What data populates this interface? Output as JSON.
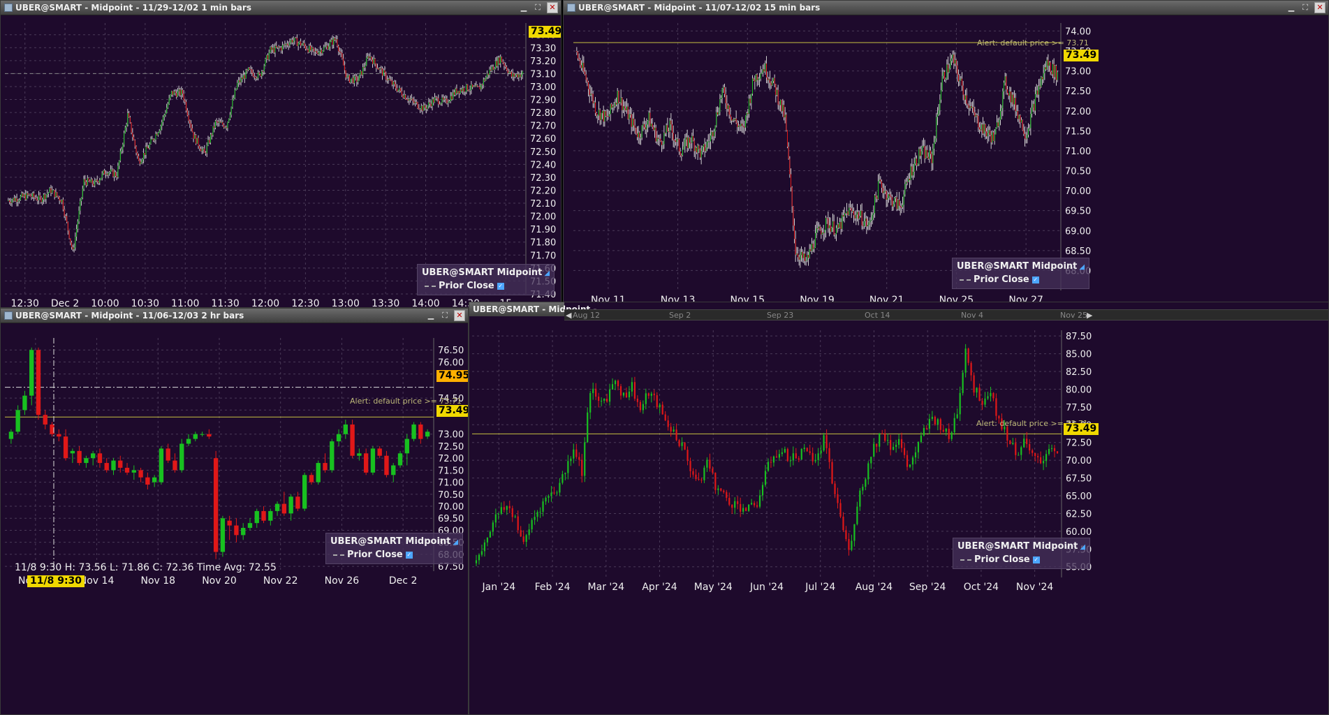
{
  "colors": {
    "bg": "#1e0a2c",
    "grid": "#4a3a58",
    "up": "#18c020",
    "down": "#e01818",
    "alert": "#c8c040",
    "tag": "#f0d800"
  },
  "panel_a": {
    "title": "UBER@SMART - Midpoint - 11/29-12/02 1 min bars",
    "price_tag": "73.49",
    "legend": {
      "series": "UBER@SMART Midpoint",
      "prior": "Prior Close"
    }
  },
  "panel_b": {
    "title": "UBER@SMART - Midpoint - 11/07-12/02 15 min bars",
    "price_tag": "73.49",
    "alert": "Alert: default price >= 73.71",
    "legend": {
      "series": "UBER@SMART Midpoint",
      "prior": "Prior Close"
    }
  },
  "panel_c": {
    "title": "UBER@SMART - Midpoint - 11/06-12/03 2 hr bars",
    "price_tag": "73.49",
    "cursor_tag": "74.95",
    "alert": "Alert: default price >= 73.71",
    "info": "11/8 9:30   H: 73.56   L: 71.86   C: 72.36   Time Avg: 72.55",
    "date_tag": "11/8 9:30",
    "legend": {
      "series": "UBER@SMART Midpoint",
      "prior": "Prior Close"
    }
  },
  "panel_d": {
    "title": "UBER@SMART - Midpoint -",
    "price_tag": "73.49",
    "alert": "Alert: default price >= 73.71",
    "scroll_labels": [
      "Aug 12",
      "Sep 2",
      "Sep 23",
      "Oct 14",
      "Nov 4",
      "Nov 25"
    ],
    "legend": {
      "series": "UBER@SMART Midpoint",
      "prior": "Prior Close"
    }
  },
  "chart_data": [
    {
      "id": "A",
      "type": "candlestick",
      "title": "UBER@SMART - Midpoint - 11/29-12/02 1 min bars",
      "ylim": [
        71.4,
        73.49
      ],
      "yticks": [
        73.4,
        73.3,
        73.2,
        73.1,
        73.0,
        72.9,
        72.8,
        72.7,
        72.6,
        72.5,
        72.4,
        72.3,
        72.2,
        72.1,
        72.0,
        71.9,
        71.8,
        71.7,
        71.6,
        71.5,
        71.4
      ],
      "xticks": [
        "12:30",
        "Dec 2",
        "10:00",
        "10:30",
        "11:00",
        "11:30",
        "12:00",
        "12:30",
        "13:00",
        "13:30",
        "14:00",
        "14:30",
        "15"
      ],
      "anchors": [
        72.12,
        72.14,
        72.16,
        72.13,
        72.2,
        72.12,
        71.72,
        72.27,
        72.25,
        72.35,
        72.32,
        72.78,
        72.42,
        72.55,
        72.7,
        72.95,
        72.95,
        72.62,
        72.48,
        72.72,
        72.7,
        73.02,
        73.12,
        73.08,
        73.28,
        73.3,
        73.36,
        73.32,
        73.26,
        73.3,
        73.37,
        73.06,
        73.05,
        73.24,
        73.13,
        73.03,
        72.95,
        72.88,
        72.83,
        72.9,
        72.88,
        72.97,
        72.99,
        72.98,
        73.12,
        73.22,
        73.08,
        73.1
      ],
      "prior_close": 73.1,
      "last": 73.49
    },
    {
      "id": "B",
      "type": "candlestick",
      "title": "UBER@SMART - Midpoint - 11/07-12/02 15 min bars",
      "ylim": [
        67.5,
        74.2
      ],
      "yticks": [
        74.0,
        73.5,
        73.0,
        72.5,
        72.0,
        71.5,
        71.0,
        70.5,
        70.0,
        69.5,
        69.0,
        68.5,
        68.0
      ],
      "xticks": [
        "Nov 11",
        "Nov 13",
        "Nov 15",
        "Nov 19",
        "Nov 21",
        "Nov 25",
        "Nov 27"
      ],
      "anchors": [
        73.5,
        72.8,
        72.0,
        71.8,
        72.4,
        71.9,
        71.4,
        71.8,
        71.2,
        71.6,
        71.0,
        71.3,
        70.9,
        71.4,
        72.5,
        71.8,
        71.5,
        72.8,
        73.1,
        72.6,
        71.8,
        68.5,
        68.2,
        68.9,
        69.2,
        69.0,
        69.5,
        69.4,
        69.1,
        70.2,
        69.8,
        69.6,
        70.5,
        71.0,
        70.8,
        72.8,
        73.3,
        72.5,
        71.9,
        71.5,
        71.3,
        72.7,
        72.1,
        71.4,
        72.4,
        73.2,
        72.9
      ],
      "alert": 73.71,
      "last": 73.49
    },
    {
      "id": "C",
      "type": "candlestick",
      "title": "UBER@SMART - Midpoint - 11/06-12/03 2 hr bars",
      "ylim": [
        67.3,
        77.0
      ],
      "yticks": [
        76.5,
        76.0,
        75.5,
        74.5,
        74.0,
        73.0,
        72.5,
        72.0,
        71.5,
        71.0,
        70.5,
        70.0,
        69.5,
        69.0,
        68.5,
        68.0,
        67.5
      ],
      "xticks": [
        "Nov 12",
        "Nov 14",
        "Nov 18",
        "Nov 20",
        "Nov 22",
        "Nov 26",
        "Dec 2"
      ],
      "ohlc": [
        [
          72.8,
          73.2,
          72.6,
          73.1
        ],
        [
          73.1,
          74.2,
          73.0,
          74.0
        ],
        [
          74.0,
          74.8,
          73.8,
          74.6
        ],
        [
          74.6,
          76.6,
          74.2,
          76.5
        ],
        [
          76.5,
          76.6,
          73.6,
          73.8
        ],
        [
          73.8,
          74.0,
          73.2,
          73.4
        ],
        [
          73.4,
          73.5,
          72.9,
          73.0
        ],
        [
          73.0,
          73.2,
          72.7,
          72.9
        ],
        [
          72.9,
          73.2,
          71.9,
          72.0
        ],
        [
          72.2,
          72.4,
          71.8,
          72.3
        ],
        [
          72.3,
          72.5,
          71.7,
          71.8
        ],
        [
          71.8,
          72.1,
          71.6,
          72.0
        ],
        [
          72.0,
          72.3,
          71.7,
          72.2
        ],
        [
          72.2,
          72.4,
          71.6,
          71.8
        ],
        [
          71.8,
          72.0,
          71.4,
          71.5
        ],
        [
          71.5,
          72.0,
          71.3,
          71.9
        ],
        [
          71.9,
          72.1,
          71.4,
          71.6
        ],
        [
          71.6,
          71.8,
          71.3,
          71.4
        ],
        [
          71.4,
          71.7,
          71.1,
          71.5
        ],
        [
          71.5,
          71.6,
          71.0,
          71.2
        ],
        [
          71.2,
          71.4,
          70.7,
          70.9
        ],
        [
          71.0,
          71.3,
          70.8,
          71.2
        ],
        [
          71.0,
          72.5,
          70.9,
          72.4
        ],
        [
          72.4,
          72.6,
          71.8,
          71.9
        ],
        [
          71.9,
          72.2,
          71.4,
          71.5
        ],
        [
          71.5,
          72.8,
          71.4,
          72.6
        ],
        [
          72.6,
          73.0,
          72.5,
          72.8
        ],
        [
          72.8,
          73.1,
          72.7,
          73.0
        ],
        [
          73.0,
          73.1,
          72.9,
          73.0
        ],
        [
          73.0,
          73.2,
          72.8,
          72.9
        ],
        [
          72.0,
          72.3,
          67.8,
          68.1
        ],
        [
          68.1,
          69.6,
          67.9,
          69.5
        ],
        [
          69.4,
          69.6,
          68.6,
          69.2
        ],
        [
          69.2,
          69.5,
          68.5,
          68.8
        ],
        [
          68.8,
          69.3,
          68.6,
          69.1
        ],
        [
          69.1,
          69.5,
          69.0,
          69.3
        ],
        [
          69.3,
          69.9,
          69.1,
          69.8
        ],
        [
          69.8,
          70.0,
          69.3,
          69.4
        ],
        [
          69.4,
          69.9,
          69.2,
          69.8
        ],
        [
          69.8,
          70.2,
          69.6,
          70.1
        ],
        [
          70.1,
          70.6,
          69.6,
          69.7
        ],
        [
          69.7,
          70.5,
          69.4,
          70.4
        ],
        [
          70.4,
          70.6,
          69.8,
          69.9
        ],
        [
          69.9,
          71.4,
          69.8,
          71.3
        ],
        [
          71.3,
          71.4,
          70.9,
          71.0
        ],
        [
          71.0,
          71.9,
          70.9,
          71.8
        ],
        [
          71.8,
          72.2,
          71.4,
          71.5
        ],
        [
          71.5,
          72.8,
          71.4,
          72.7
        ],
        [
          72.7,
          73.2,
          72.5,
          73.0
        ],
        [
          73.0,
          73.6,
          72.8,
          73.4
        ],
        [
          73.4,
          73.6,
          72.0,
          72.1
        ],
        [
          72.1,
          72.4,
          71.9,
          72.2
        ],
        [
          72.2,
          72.4,
          71.3,
          71.4
        ],
        [
          71.4,
          72.5,
          71.3,
          72.4
        ],
        [
          72.4,
          72.5,
          72.0,
          72.1
        ],
        [
          72.1,
          72.3,
          71.2,
          71.3
        ],
        [
          71.3,
          71.8,
          71.0,
          71.7
        ],
        [
          71.7,
          72.3,
          71.6,
          72.2
        ],
        [
          72.2,
          73.0,
          71.7,
          72.8
        ],
        [
          72.8,
          73.5,
          72.7,
          73.4
        ],
        [
          73.4,
          73.5,
          72.6,
          72.8
        ],
        [
          72.9,
          73.2,
          72.8,
          73.1
        ]
      ],
      "alert": 73.71,
      "last": 73.49,
      "cursor_price": 74.95
    },
    {
      "id": "D",
      "type": "candlestick",
      "title": "UBER@SMART - Midpoint -",
      "ylim": [
        53.5,
        88.3
      ],
      "yticks": [
        87.5,
        85.0,
        82.5,
        80.0,
        77.5,
        75.0,
        72.5,
        70.0,
        67.5,
        65.0,
        62.5,
        60.0,
        57.5,
        55.0
      ],
      "xticks": [
        "Jan '24",
        "Feb '24",
        "Mar '24",
        "Apr '24",
        "May '24",
        "Jun '24",
        "Jul '24",
        "Aug '24",
        "Sep '24",
        "Oct '24",
        "Nov '24"
      ],
      "anchors": [
        55.5,
        57.5,
        60.5,
        62.5,
        63.5,
        62.0,
        58.0,
        61.5,
        63.5,
        65.0,
        66.0,
        68.5,
        72.0,
        68.5,
        80.0,
        78.0,
        79.0,
        81.5,
        79.0,
        80.5,
        77.0,
        79.5,
        78.0,
        75.5,
        74.0,
        72.0,
        69.0,
        66.5,
        70.0,
        66.5,
        65.0,
        64.0,
        63.5,
        63.0,
        64.0,
        68.0,
        71.0,
        71.0,
        70.5,
        70.5,
        72.0,
        69.5,
        73.0,
        67.0,
        62.0,
        57.0,
        64.0,
        68.0,
        72.0,
        74.0,
        72.0,
        73.0,
        69.0,
        71.0,
        74.0,
        76.0,
        75.0,
        73.0,
        77.0,
        86.0,
        80.0,
        78.5,
        80.0,
        75.5,
        73.5,
        71.0,
        72.5,
        70.5,
        69.5,
        72.0,
        71.5
      ],
      "alert": 73.71,
      "last": 73.49
    }
  ]
}
